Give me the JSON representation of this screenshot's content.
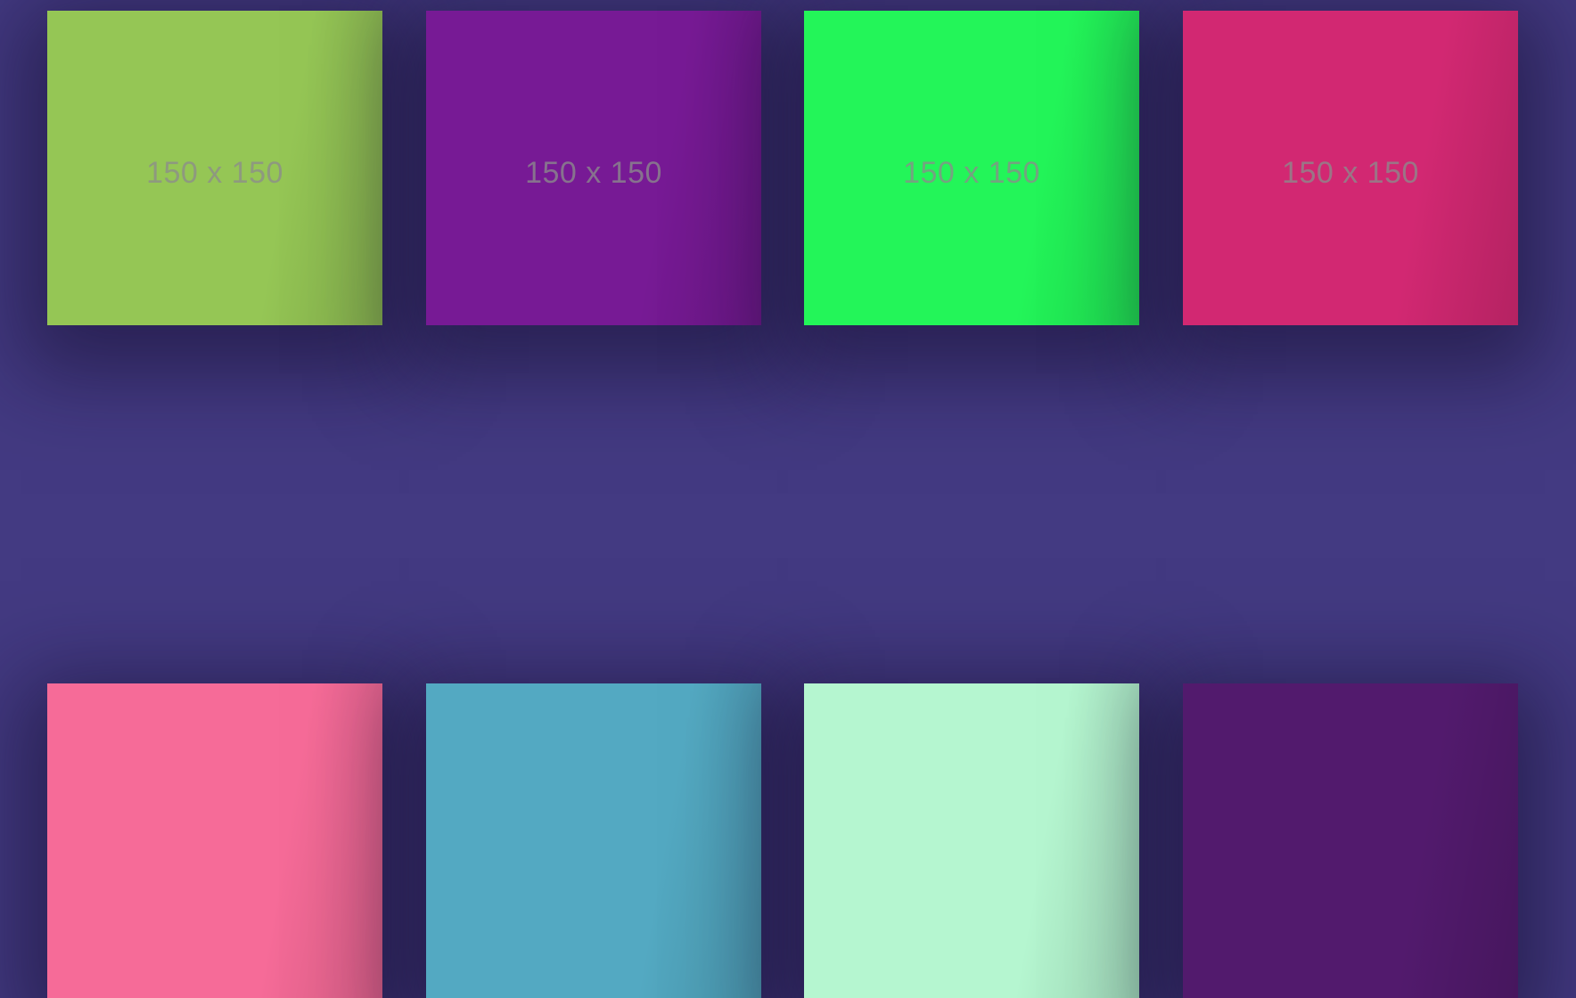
{
  "gallery": {
    "tiles": [
      {
        "label": "150 x 150",
        "color": "#95c655"
      },
      {
        "label": "150 x 150",
        "color": "#771a95"
      },
      {
        "label": "150 x 150",
        "color": "#23f559"
      },
      {
        "label": "150 x 150",
        "color": "#d22872"
      },
      {
        "label": "",
        "color": "#f66b98"
      },
      {
        "label": "",
        "color": "#53a9c2"
      },
      {
        "label": "",
        "color": "#b5f6d0"
      },
      {
        "label": "",
        "color": "#521a6d"
      }
    ]
  }
}
